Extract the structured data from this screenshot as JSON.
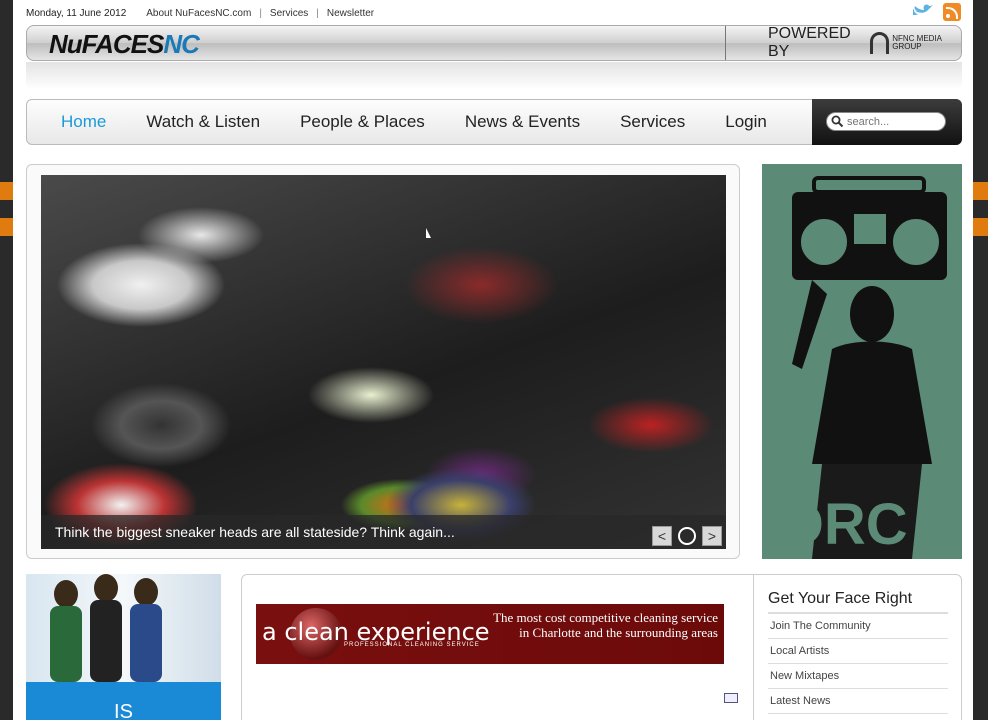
{
  "topbar": {
    "date": "Monday, 11 June 2012",
    "links": [
      "About NuFacesNC.com",
      "Services",
      "Newsletter"
    ]
  },
  "header": {
    "logo_main": "NuFACES",
    "logo_accent": "NC",
    "powered_by": "POWERED BY",
    "group_name": "NFNC MEDIA GROUP"
  },
  "nav": {
    "items": [
      "Home",
      "Watch & Listen",
      "People & Places",
      "News & Events",
      "Services",
      "Login"
    ],
    "active": "Home"
  },
  "search": {
    "placeholder": "search..."
  },
  "slider": {
    "caption": "Think the biggest sneaker heads are all stateside? Think again...",
    "prev": "<",
    "next": ">"
  },
  "promo": {
    "label": "IS"
  },
  "banner": {
    "logo": "a clean experience",
    "subtitle": "PROFESSIONAL CLEANING SERVICE",
    "tagline": "The most cost competitive cleaning service in Charlotte and the surrounding areas"
  },
  "sidebar": {
    "title": "Get Your Face Right",
    "links": [
      "Join The Community",
      "Local Artists",
      "New Mixtapes",
      "Latest News"
    ]
  },
  "colors": {
    "accent": "#1a9bd7",
    "brand": "#1a7ab8",
    "banner": "#7a0f0f",
    "ad": "#5b8a76"
  }
}
